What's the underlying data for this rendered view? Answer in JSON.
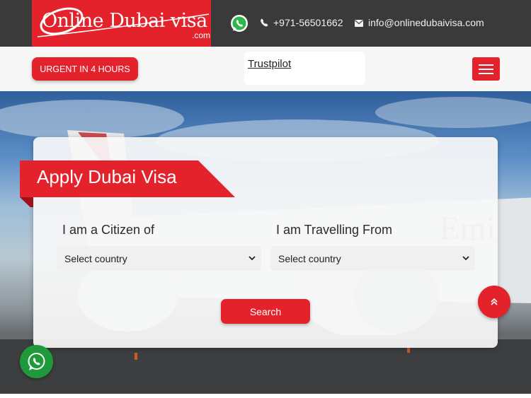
{
  "header": {
    "logo_main": "Online Dubai visa",
    "logo_sub": ".com",
    "phone": "+971-56501662",
    "email": "info@onlinedubaivisa.com"
  },
  "nav": {
    "urgent_label": "URGENT IN 4 HOURS",
    "trustpilot_link": "Trustpilot"
  },
  "form": {
    "title": "Apply Dubai Visa",
    "citizen_label": "I am a Citizen of",
    "travelling_label": "I am Travelling From",
    "citizen_select": "Select country",
    "travelling_select": "Select country",
    "search_label": "Search"
  },
  "icons": {
    "whatsapp": "whatsapp-icon",
    "phone": "phone-icon",
    "mail": "mail-icon",
    "menu": "hamburger-menu-icon",
    "scroll_top": "double-chevron-up-icon"
  },
  "colors": {
    "brand_red": "#e3222b",
    "topbar": "#3a3a3a",
    "whatsapp_green": "#1e9a3b"
  }
}
